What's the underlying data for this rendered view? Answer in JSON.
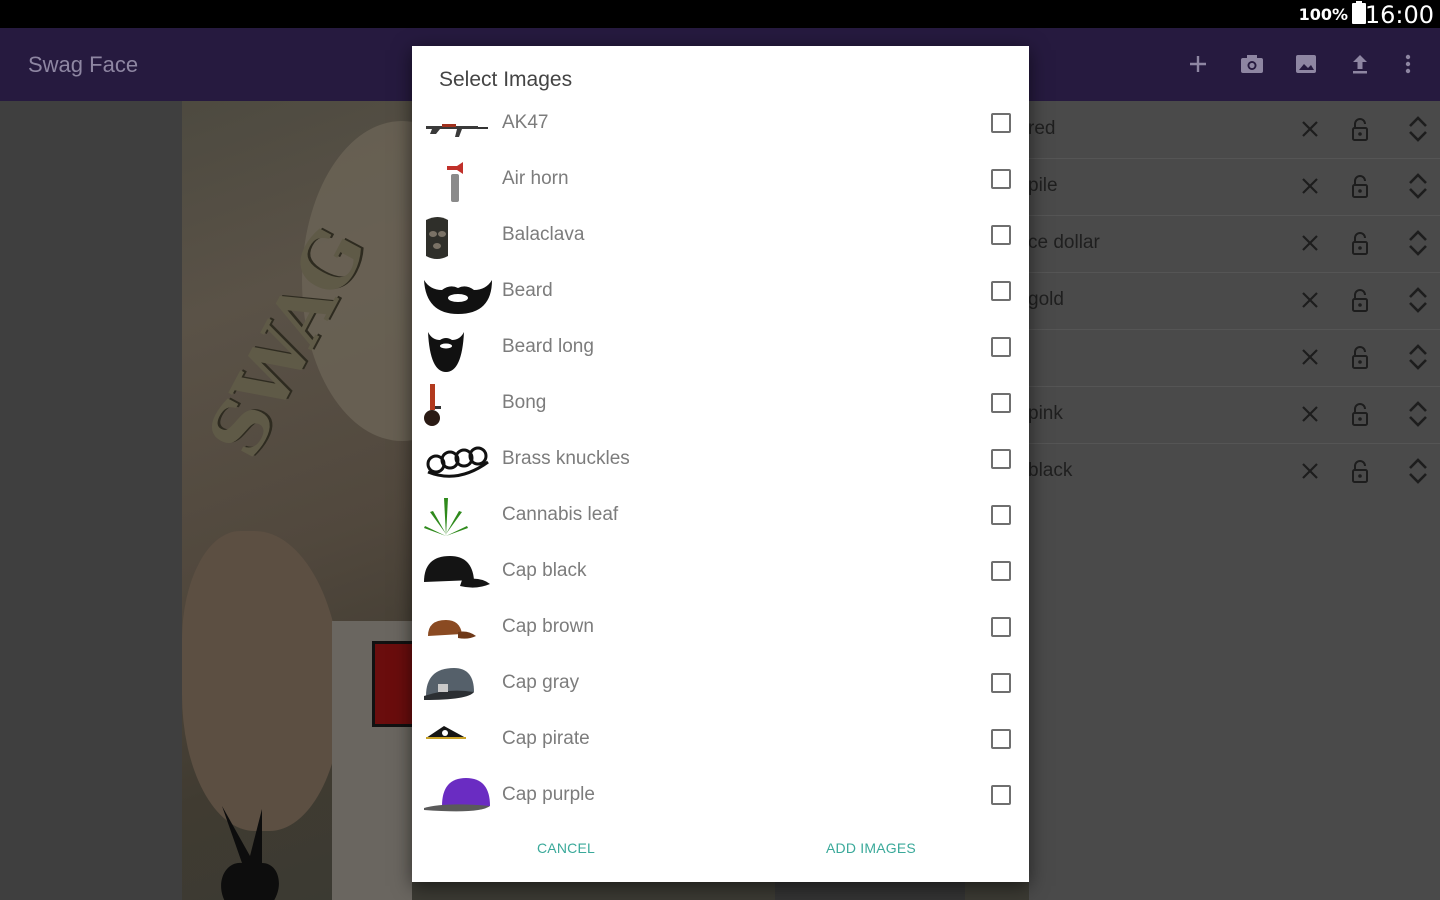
{
  "status_bar": {
    "battery": "100%",
    "time": "16:00"
  },
  "app_bar": {
    "title": "Swag Face",
    "actions": [
      "plus-icon",
      "camera-icon",
      "image-icon",
      "upload-icon",
      "more-vert-icon"
    ]
  },
  "background_list": {
    "rows": [
      {
        "label": "red"
      },
      {
        "label": "pile"
      },
      {
        "label": "ce dollar"
      },
      {
        "label": "gold"
      },
      {
        "label": ""
      },
      {
        "label": "pink"
      },
      {
        "label": "black"
      }
    ]
  },
  "photo": {
    "text": "SWAG"
  },
  "dialog": {
    "title": "Select Images",
    "items": [
      {
        "label": "AK47",
        "icon": "ak47-icon",
        "checked": false
      },
      {
        "label": "Air horn",
        "icon": "air-horn-icon",
        "checked": false
      },
      {
        "label": "Balaclava",
        "icon": "balaclava-icon",
        "checked": false
      },
      {
        "label": "Beard",
        "icon": "beard-icon",
        "checked": false
      },
      {
        "label": "Beard long",
        "icon": "beard-long-icon",
        "checked": false
      },
      {
        "label": "Bong",
        "icon": "bong-icon",
        "checked": false
      },
      {
        "label": "Brass knuckles",
        "icon": "brass-knuckles-icon",
        "checked": false
      },
      {
        "label": "Cannabis leaf",
        "icon": "cannabis-leaf-icon",
        "checked": false
      },
      {
        "label": "Cap black",
        "icon": "cap-black-icon",
        "checked": false
      },
      {
        "label": "Cap brown",
        "icon": "cap-brown-icon",
        "checked": false
      },
      {
        "label": "Cap gray",
        "icon": "cap-gray-icon",
        "checked": false
      },
      {
        "label": "Cap pirate",
        "icon": "cap-pirate-icon",
        "checked": false
      },
      {
        "label": "Cap purple",
        "icon": "cap-purple-icon",
        "checked": false
      }
    ],
    "cancel_label": "CANCEL",
    "add_label": "ADD IMAGES"
  },
  "colors": {
    "app_bar": "#261a3f",
    "accent": "#3aa99a"
  }
}
